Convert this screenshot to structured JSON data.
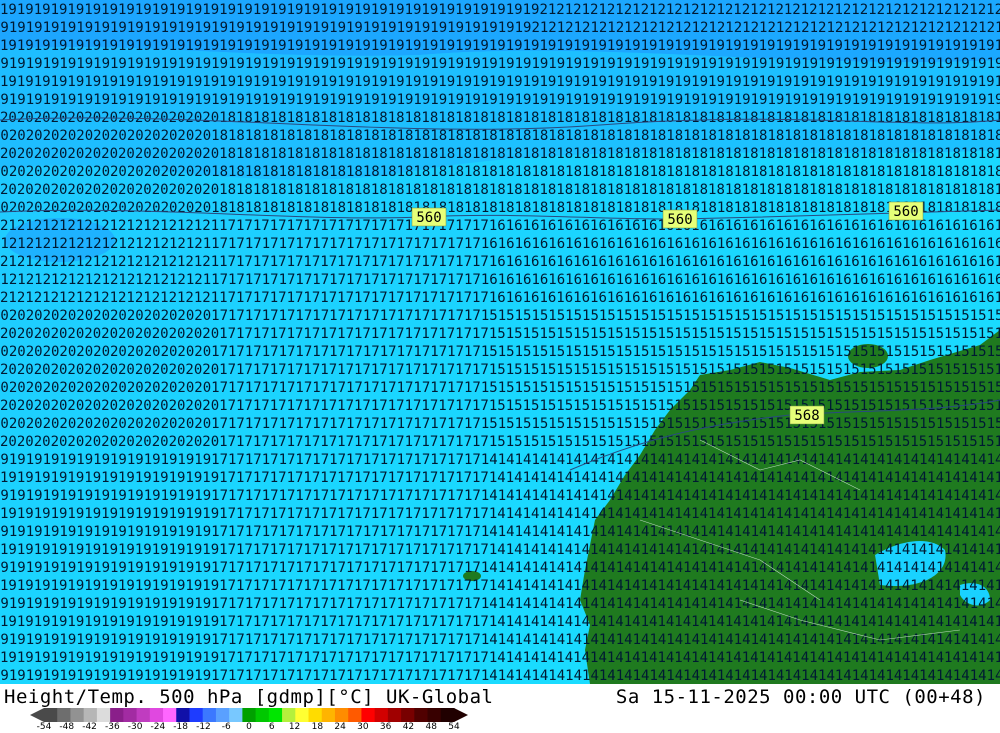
{
  "title_left": "Height/Temp. 500 hPa [gdmp][°C] UK-Global",
  "title_right": "Sa 15-11-2025 00:00 UTC (00+48)",
  "contour_labels": [
    "560",
    "560",
    "560",
    "568"
  ],
  "colorbar": {
    "ticks": [
      "-54",
      "-48",
      "-42",
      "-36",
      "-30",
      "-24",
      "-18",
      "-12",
      "-6",
      "0",
      "6",
      "12",
      "18",
      "24",
      "30",
      "36",
      "42",
      "48",
      "54"
    ],
    "colors": [
      "#4a4a4a",
      "#6e6e6e",
      "#929292",
      "#b6b6b6",
      "#dcdcdc",
      "#8a1f8a",
      "#a22ba2",
      "#c03cc0",
      "#e048e0",
      "#ff66ff",
      "#1010a8",
      "#1e3cff",
      "#3c78ff",
      "#5aa0ff",
      "#78c8ff",
      "#00a000",
      "#00c800",
      "#00e600",
      "#b4f03c",
      "#ffff32",
      "#ffdc00",
      "#ffb400",
      "#ff8c00",
      "#ff5a00",
      "#ff0000",
      "#d20000",
      "#a00000",
      "#780000",
      "#500000",
      "#380000",
      "#200000"
    ]
  },
  "colors": {
    "sea": "#19d2ff",
    "land": "#1f7a1f",
    "contour": "#2a4a80",
    "label_box": "#e6ff78"
  }
}
